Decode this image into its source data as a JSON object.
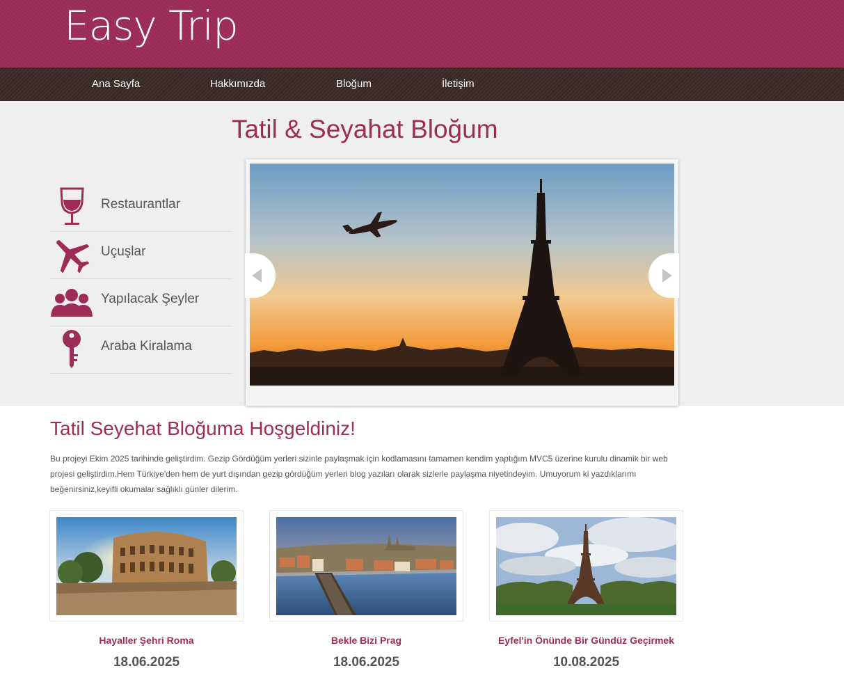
{
  "site": {
    "logo": "Easy Trip"
  },
  "nav": {
    "items": [
      {
        "label": "Ana Sayfa"
      },
      {
        "label": "Hakkımızda"
      },
      {
        "label": "Bloğum"
      },
      {
        "label": "İletişim"
      }
    ]
  },
  "hero": {
    "title": "Tatil & Seyahat Bloğum",
    "categories": [
      {
        "label": "Restaurantlar",
        "icon": "wine-glass-icon"
      },
      {
        "label": "Uçuşlar",
        "icon": "airplane-icon"
      },
      {
        "label": "Yapılacak Şeyler",
        "icon": "people-icon"
      },
      {
        "label": "Araba Kiralama",
        "icon": "key-icon"
      }
    ]
  },
  "welcome": {
    "title": "Tatil Seyehat Bloğuma Hoşgeldiniz!",
    "text": "Bu projeyi Ekim 2025 tarihinde geliştirdim. Gezip Gördüğüm yerleri sizinle paylaşmak için kodlamasını tamamen kendim yaptığım MVC5 üzerine kurulu dinamik bir web projesi geliştirdim.Hem Türkiye'den hem de yurt dışından gezip gördüğüm yerleri blog yazıları olarak sizlerle paylaşma niyetindeyim. Umuyorum ki yazdıklarımı beğenirsiniz,keyifli okumalar sağlıklı günler dilerim."
  },
  "posts": [
    {
      "title": "Hayaller Şehri Roma",
      "date": "18.06.2025"
    },
    {
      "title": "Bekle Bizi Prag",
      "date": "18.06.2025"
    },
    {
      "title": "Eyfel'in Önünde Bir Gündüz Geçirmek",
      "date": "10.08.2025"
    }
  ],
  "colors": {
    "brand": "#9d2d56",
    "nav": "#3b2a28",
    "hero_bg": "#efefef"
  }
}
